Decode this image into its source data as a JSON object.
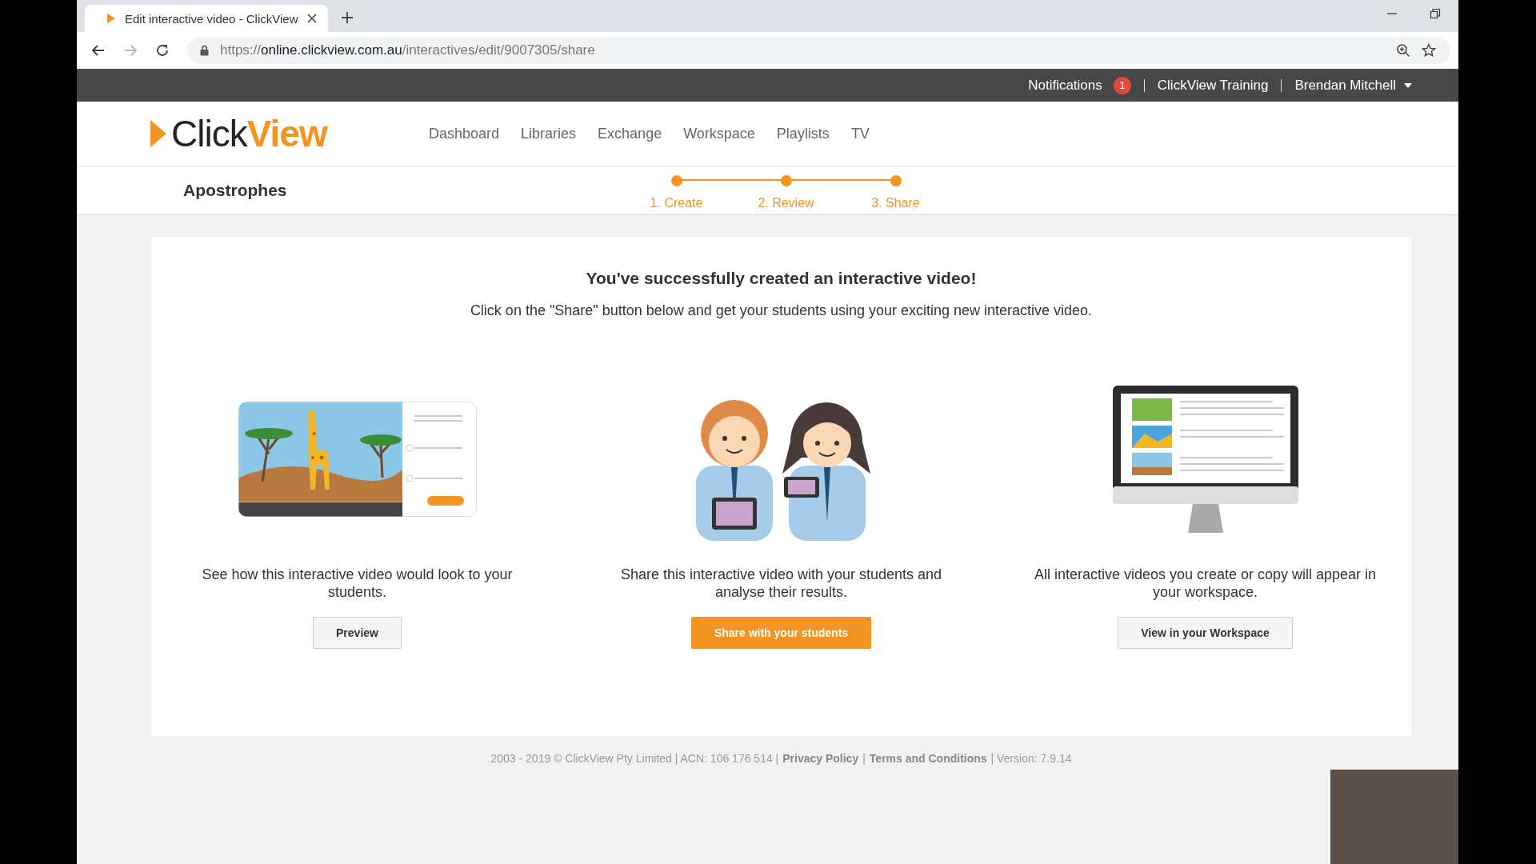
{
  "browser": {
    "tab_title": "Edit interactive video - ClickView",
    "url_scheme": "https://",
    "url_host": "online.clickview.com.au",
    "url_path": "/interactives/edit/9007305/share"
  },
  "top_bar": {
    "notifications_label": "Notifications",
    "notifications_count": "1",
    "items": [
      "ClickView Training",
      "Brendan Mitchell"
    ]
  },
  "logo": {
    "part_1": "Click",
    "part_2": "View"
  },
  "nav": [
    "Dashboard",
    "Libraries",
    "Exchange",
    "Workspace",
    "Playlists",
    "TV"
  ],
  "project_title": "Apostrophes",
  "steps": [
    {
      "label": "1. Create",
      "done": true
    },
    {
      "label": "2. Review",
      "done": true
    },
    {
      "label": "3. Share",
      "done": true
    }
  ],
  "card": {
    "heading": "You've successfully created an interactive video!",
    "subheading": "Click on the \"Share\" button below and get your students using your exciting new interactive video.",
    "options": [
      {
        "kind": "preview",
        "text": "See how this interactive video would look to your students.",
        "button": "Preview",
        "primary": false
      },
      {
        "kind": "share",
        "text": "Share this interactive video with your students and analyse their results.",
        "button": "Share with your students",
        "primary": true
      },
      {
        "kind": "workspace",
        "text": "All interactive videos you create or copy will appear in your workspace.",
        "button": "View in your Workspace",
        "primary": false
      }
    ]
  },
  "footer": {
    "copyright": "2003 - 2019 © ClickView Pty Limited | ACN: 106 176 514 |",
    "links": [
      "Privacy Policy",
      "Terms and Conditions"
    ],
    "separator": "|",
    "version": "| Version: 7.9.14"
  }
}
